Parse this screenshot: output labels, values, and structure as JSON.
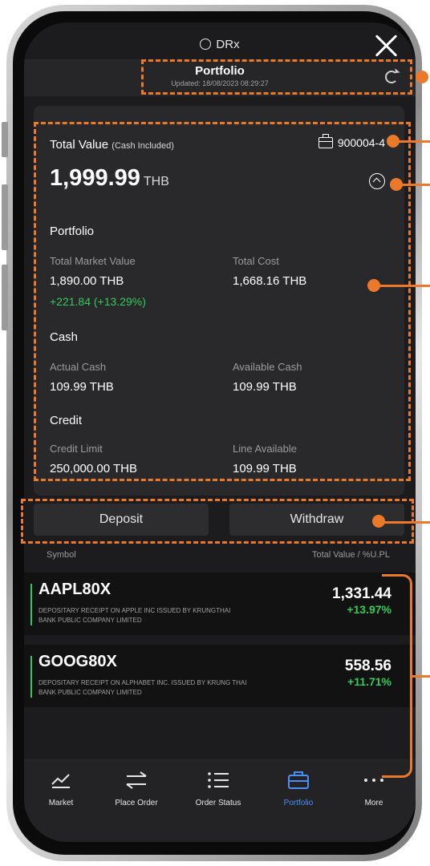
{
  "app": {
    "brand": "DRx"
  },
  "header": {
    "title": "Portfolio",
    "updated": "Updated: 18/08/2023 08:29:27"
  },
  "summary": {
    "total_value_label": "Total Value",
    "total_value_note": "(Cash Included)",
    "account": "900004-4",
    "total_value": "1,999.99",
    "currency": "THB"
  },
  "portfolio": {
    "title": "Portfolio",
    "market_value_label": "Total Market Value",
    "market_value": "1,890.00 THB",
    "total_cost_label": "Total Cost",
    "total_cost": "1,668.16 THB",
    "gain": "+221.84 (+13.29%)"
  },
  "cash": {
    "title": "Cash",
    "actual_label": "Actual Cash",
    "actual": "109.99 THB",
    "available_label": "Available Cash",
    "available": "109.99 THB"
  },
  "credit": {
    "title": "Credit",
    "limit_label": "Credit Limit",
    "limit": "250,000.00 THB",
    "line_label": "Line Available",
    "line": "109.99 THB"
  },
  "actions": {
    "deposit": "Deposit",
    "withdraw": "Withdraw"
  },
  "list": {
    "symbol_header": "Symbol",
    "value_header": "Total Value / %U.PL",
    "holdings": [
      {
        "symbol": "AAPL80X",
        "description": "DEPOSITARY RECEIPT ON APPLE INC ISSUED BY KRUNGTHAI BANK PUBLIC COMPANY LIMITED",
        "value": "1,331.44",
        "pct": "+13.97%"
      },
      {
        "symbol": "GOOG80X",
        "description": "DEPOSITARY RECEIPT ON ALPHABET INC. ISSUED BY KRUNG THAI BANK PUBLIC COMPANY LIMITED",
        "value": "558.56",
        "pct": "+11.71%"
      }
    ]
  },
  "tabs": [
    {
      "label": "Market",
      "icon": "chart-icon"
    },
    {
      "label": "Place Order",
      "icon": "swap-icon"
    },
    {
      "label": "Order Status",
      "icon": "list-icon"
    },
    {
      "label": "Portfolio",
      "icon": "briefcase-icon",
      "active": true
    },
    {
      "label": "More",
      "icon": "more-icon"
    }
  ],
  "colors": {
    "accent": "#4a8ff7",
    "gain": "#2ecc5a",
    "annotation": "#ea7a2a"
  }
}
